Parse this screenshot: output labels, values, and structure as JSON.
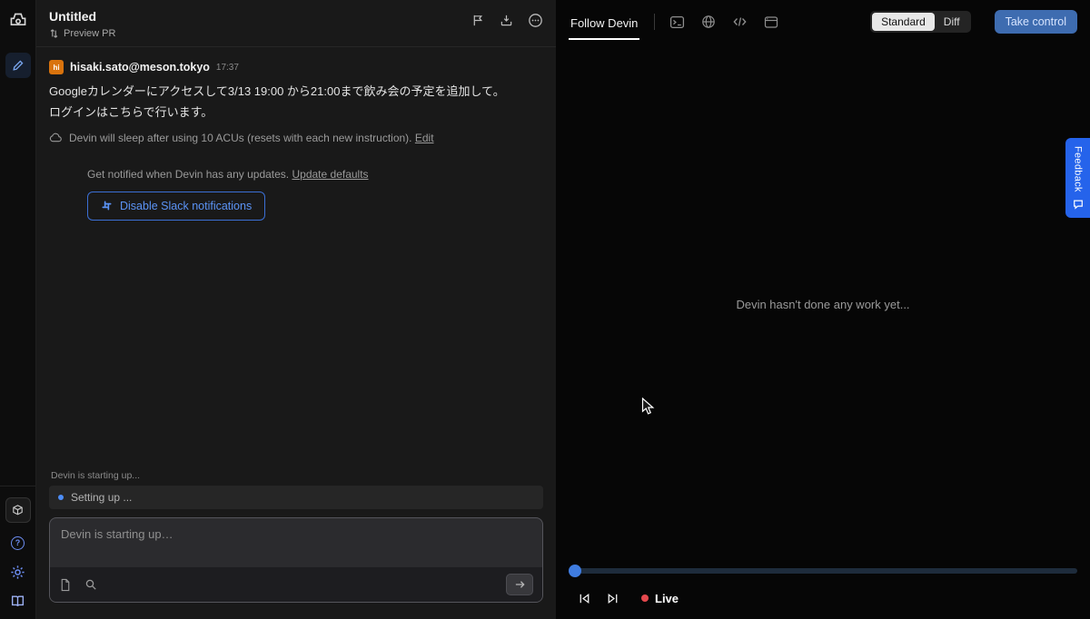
{
  "colors": {
    "accent": "#4d8df6",
    "feedback_tab": "#2563eb",
    "live": "#e5484d",
    "avatar_bg": "#d9730d",
    "take_control_bg": "#3e6cb0",
    "standard_toggle_bg": "#e8e8e8"
  },
  "icons": [
    "devin-logo-icon",
    "new-session-icon",
    "machine-icon",
    "help-icon",
    "settings-icon",
    "docs-icon",
    "pr-icon",
    "flag-icon",
    "save-icon",
    "more-icon",
    "cloud-icon",
    "slack-icon",
    "file-icon",
    "search-icon",
    "send-arrow-icon",
    "terminal-icon",
    "globe-icon",
    "code-icon",
    "browser-icon",
    "skip-back-icon",
    "skip-forward-icon",
    "live-dot",
    "feedback-bubble-icon",
    "cursor-pointer"
  ],
  "header": {
    "title": "Untitled",
    "preview_pr": "Preview PR"
  },
  "message": {
    "avatar": "hi",
    "sender": "hisaki.sato@meson.tokyo",
    "time": "17:37",
    "line1": "Googleカレンダーにアクセスして3/13 19:00 から21:00まで飲み会の予定を追加して。",
    "line2": "ログインはこちらで行います。",
    "acu_note": "Devin will sleep after using 10 ACUs (resets with each new instruction).",
    "acu_edit": "Edit"
  },
  "notifications": {
    "text": "Get notified when Devin has any updates.",
    "link": "Update defaults",
    "button": "Disable Slack notifications"
  },
  "status": {
    "starting": "Devin is starting up...",
    "setting_up": "Setting up ..."
  },
  "composer": {
    "placeholder": "Devin is starting up…"
  },
  "workspace": {
    "tab": "Follow Devin",
    "empty": "Devin hasn't done any work yet...",
    "toggle_standard": "Standard",
    "toggle_diff": "Diff",
    "take_control": "Take control",
    "live": "Live"
  },
  "feedback_label": "Feedback"
}
